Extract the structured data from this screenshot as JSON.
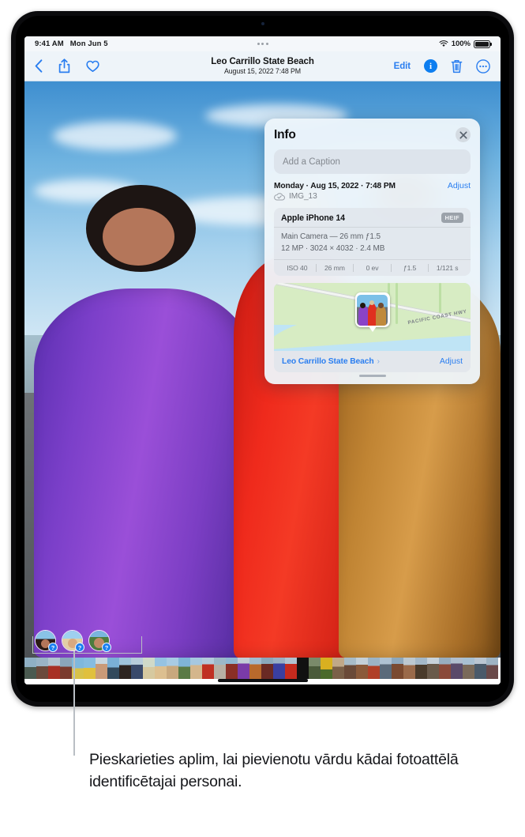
{
  "status_bar": {
    "time": "9:41 AM",
    "date": "Mon Jun 5",
    "battery_percent": "100%",
    "wifi_icon": "wifi-icon",
    "battery_icon": "battery-full-icon",
    "multitask_handle_icon": "multitasking-dots-icon"
  },
  "toolbar": {
    "back_icon": "chevron-left-icon",
    "share_icon": "share-upload-icon",
    "favorite_icon": "heart-outline-icon",
    "title": "Leo Carrillo State Beach",
    "subtitle": "August 15, 2022  7:48 PM",
    "edit_label": "Edit",
    "info_icon": "info-circle-filled-icon",
    "info_glyph": "i",
    "trash_icon": "trash-icon",
    "more_icon": "ellipsis-circle-icon"
  },
  "info_panel": {
    "title": "Info",
    "close_icon": "close-x-icon",
    "caption_placeholder": "Add a Caption",
    "date_line": "Monday · Aug 15, 2022 · 7:48 PM",
    "adjust_date_label": "Adjust",
    "cloud_icon": "cloud-check-icon",
    "file_name": "IMG_13",
    "camera": {
      "device": "Apple iPhone 14",
      "format_badge": "HEIF",
      "lens_line": "Main Camera — 26 mm ƒ1.5",
      "spec_line": "12 MP · 3024 × 4032 · 2.4 MB",
      "exif": [
        "ISO 40",
        "26 mm",
        "0 ev",
        "ƒ1.5",
        "1/121 s"
      ]
    },
    "map": {
      "road_label": "PACIFIC COAST HWY",
      "pin_icon": "photo-map-pin-icon",
      "location_name": "Leo Carrillo State Beach",
      "chevron_icon": "chevron-right-icon",
      "adjust_location_label": "Adjust"
    },
    "grabber_icon": "drag-grabber-icon"
  },
  "faces": {
    "badge_glyph": "?",
    "items": [
      {
        "name": "face-circle-1"
      },
      {
        "name": "face-circle-2"
      },
      {
        "name": "face-circle-3"
      }
    ]
  },
  "filmstrip": {
    "home_indicator_icon": "home-indicator-icon"
  },
  "callout": {
    "text": "Pieskarieties aplim, lai pievienotu vārdu kādai fotoattēlā identificētajai personai."
  },
  "colors": {
    "accent_blue": "#2a7ef0",
    "info_blue": "#0d7ef0",
    "panel_bg": "#eef5fb",
    "card_bg": "#e0e5eb",
    "badge_grey": "#9ba2aa",
    "map_land": "#d7ecc3",
    "map_water": "#bfe4f5"
  }
}
